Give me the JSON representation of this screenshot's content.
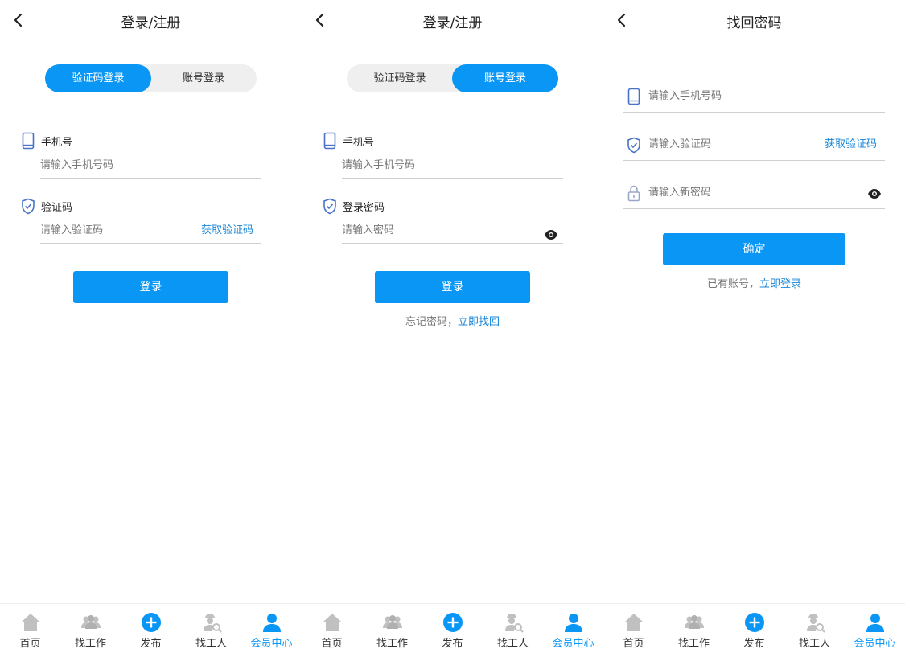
{
  "screens": [
    {
      "title": "登录/注册",
      "tabs": {
        "left": "验证码登录",
        "right": "账号登录"
      },
      "phone_label": "手机号",
      "phone_placeholder": "请输入手机号码",
      "code_label": "验证码",
      "code_placeholder": "请输入验证码",
      "get_code": "获取验证码",
      "login_button": "登录"
    },
    {
      "title": "登录/注册",
      "tabs": {
        "left": "验证码登录",
        "right": "账号登录"
      },
      "phone_label": "手机号",
      "phone_placeholder": "请输入手机号码",
      "password_label": "登录密码",
      "password_placeholder": "请输入密码",
      "login_button": "登录",
      "forgot_text": "忘记密码，",
      "forgot_link": "立即找回"
    },
    {
      "title": "找回密码",
      "phone_placeholder": "请输入手机号码",
      "code_placeholder": "请输入验证码",
      "get_code": "获取验证码",
      "newpass_placeholder": "请输入新密码",
      "confirm_button": "确定",
      "has_account": "已有账号，",
      "login_link": "立即登录"
    }
  ],
  "tabbar": [
    {
      "label": "首页",
      "icon": "home-icon"
    },
    {
      "label": "找工作",
      "icon": "find-job-icon"
    },
    {
      "label": "发布",
      "icon": "publish-icon"
    },
    {
      "label": "找工人",
      "icon": "find-worker-icon"
    },
    {
      "label": "会员中心",
      "icon": "member-icon",
      "active": true
    }
  ],
  "colors": {
    "accent": "#0a96f5",
    "link": "#1a86d8",
    "divider": "#cfcfcf",
    "icon_gray": "#c0c0c0"
  }
}
